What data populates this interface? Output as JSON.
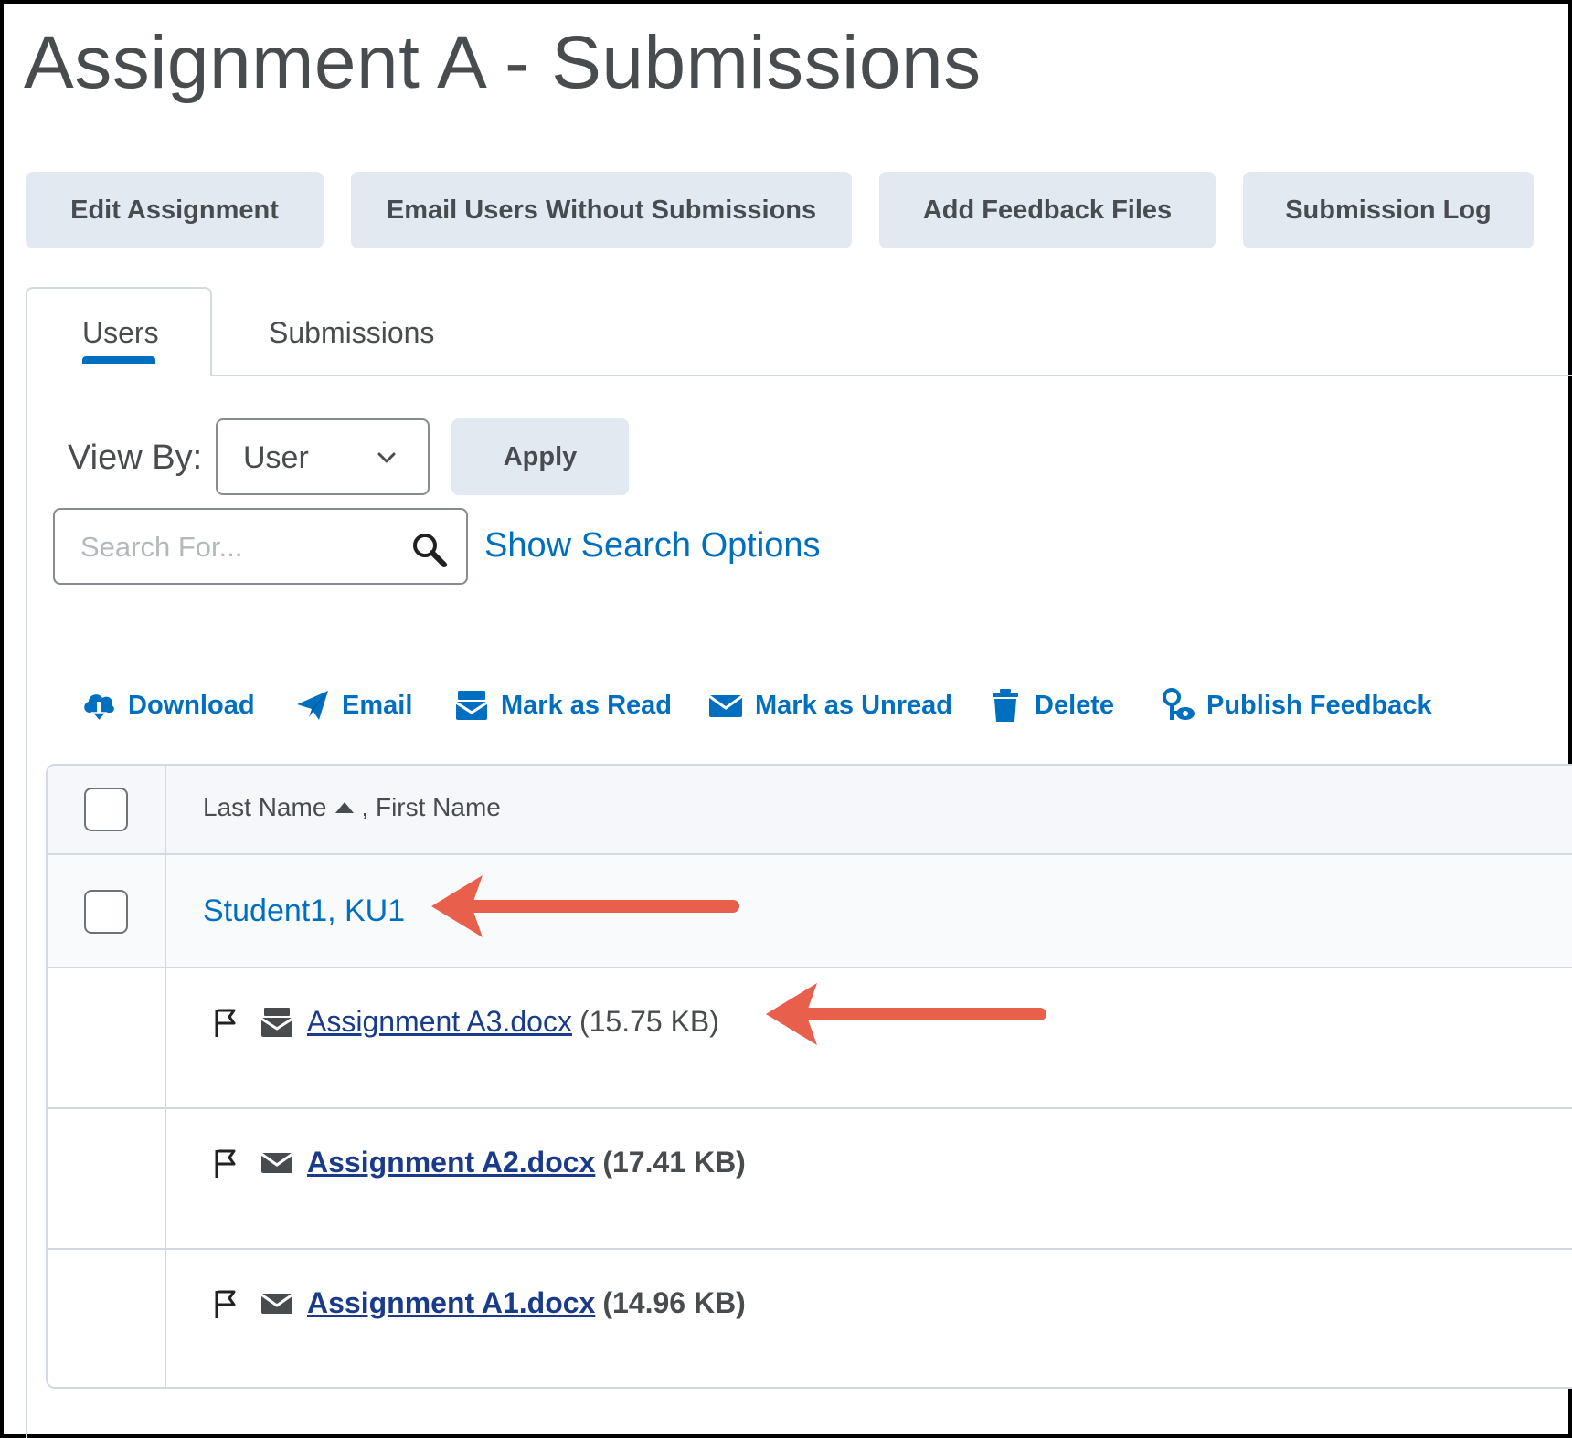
{
  "page": {
    "title": "Assignment A - Submissions"
  },
  "actions": {
    "edit_assignment": "Edit Assignment",
    "email_without": "Email Users Without Submissions",
    "add_feedback": "Add Feedback Files",
    "submission_log": "Submission Log"
  },
  "tabs": [
    {
      "label": "Users",
      "active": true
    },
    {
      "label": "Submissions",
      "active": false
    }
  ],
  "filter": {
    "view_by_label": "View By:",
    "view_by_value": "User",
    "apply_label": "Apply",
    "search_placeholder": "Search For...",
    "show_search_options": "Show Search Options"
  },
  "toolbar": {
    "download": "Download",
    "email": "Email",
    "mark_read": "Mark as Read",
    "mark_unread": "Mark as Unread",
    "delete": "Delete",
    "publish_feedback": "Publish Feedback"
  },
  "table": {
    "header": {
      "last_name": "Last Name",
      "first_name": ", First Name"
    },
    "student": "Student1, KU1",
    "files": [
      {
        "name": "Assignment A3.docx",
        "size": "(15.75 KB)",
        "read": true
      },
      {
        "name": "Assignment A2.docx",
        "size": "(17.41 KB)",
        "read": false
      },
      {
        "name": "Assignment A1.docx",
        "size": "(14.96 KB)",
        "read": false
      }
    ]
  },
  "colors": {
    "accent": "#006fbf",
    "button_bg": "#e3e9f1",
    "annotation_arrow": "#e8604c",
    "file_link": "#1a3a8a"
  }
}
